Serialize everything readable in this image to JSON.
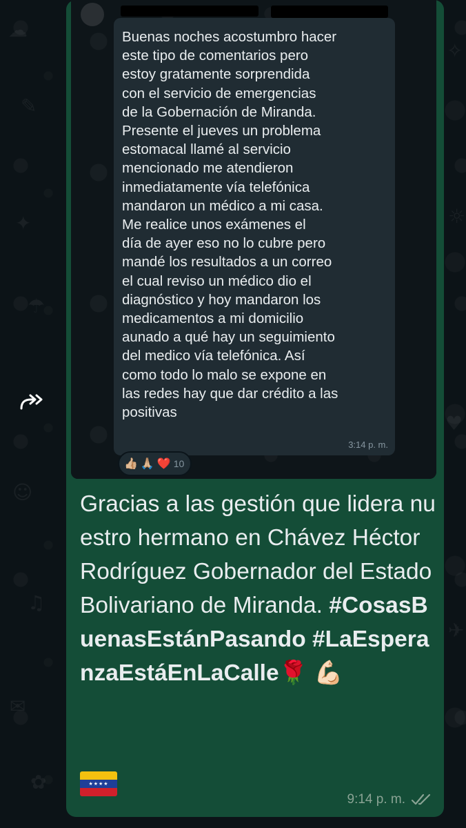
{
  "quoted_message": {
    "text": "Buenas noches acostumbro hacer\neste tipo de comentarios pero\nestoy gratamente sorprendida\ncon el servicio de emergencias\nde la Gobernación de Miranda.\nPresente el jueves un problema\nestomacal llamé al servicio\nmencionado me atendieron\ninmediatamente vía telefónica\nmandaron un médico a mi casa.\nMe realice unos exámenes el\ndía de ayer eso no lo cubre pero\nmandé los resultados a un correo\nel cual reviso un médico dio el\ndiagnóstico y hoy mandaron los\nmedicamentos a mi domicilio\naunado a qué hay un seguimiento\ndel medico vía telefónica. Así\ncomo todo lo malo se expone en\nlas redes hay que dar crédito a las\npositivas",
    "time": "3:14 p. m.",
    "reactions": {
      "emojis": [
        "👍🏼",
        "🙏🏼",
        "❤️"
      ],
      "count": "10"
    }
  },
  "caption": {
    "text": "Gracias a las gestión que lidera nuestro hermano en Chávez Héctor Rodríguez Gobernador del Estado Bolivariano de Miranda.",
    "hashtag1": "#CosasBuenasEstánPasando",
    "hashtag2": "#LaEsperanzaEstáEnLaCalle",
    "emojis": "🌹 💪🏻"
  },
  "message": {
    "time": "9:14 p. m.",
    "status_icon": "double-check-icon",
    "flag_icon": "venezuela-flag-icon"
  },
  "forward_icon": "forward-icon",
  "colors": {
    "bubble": "#144d37",
    "background": "#0b141a",
    "quoted_bubble": "#202c33"
  }
}
